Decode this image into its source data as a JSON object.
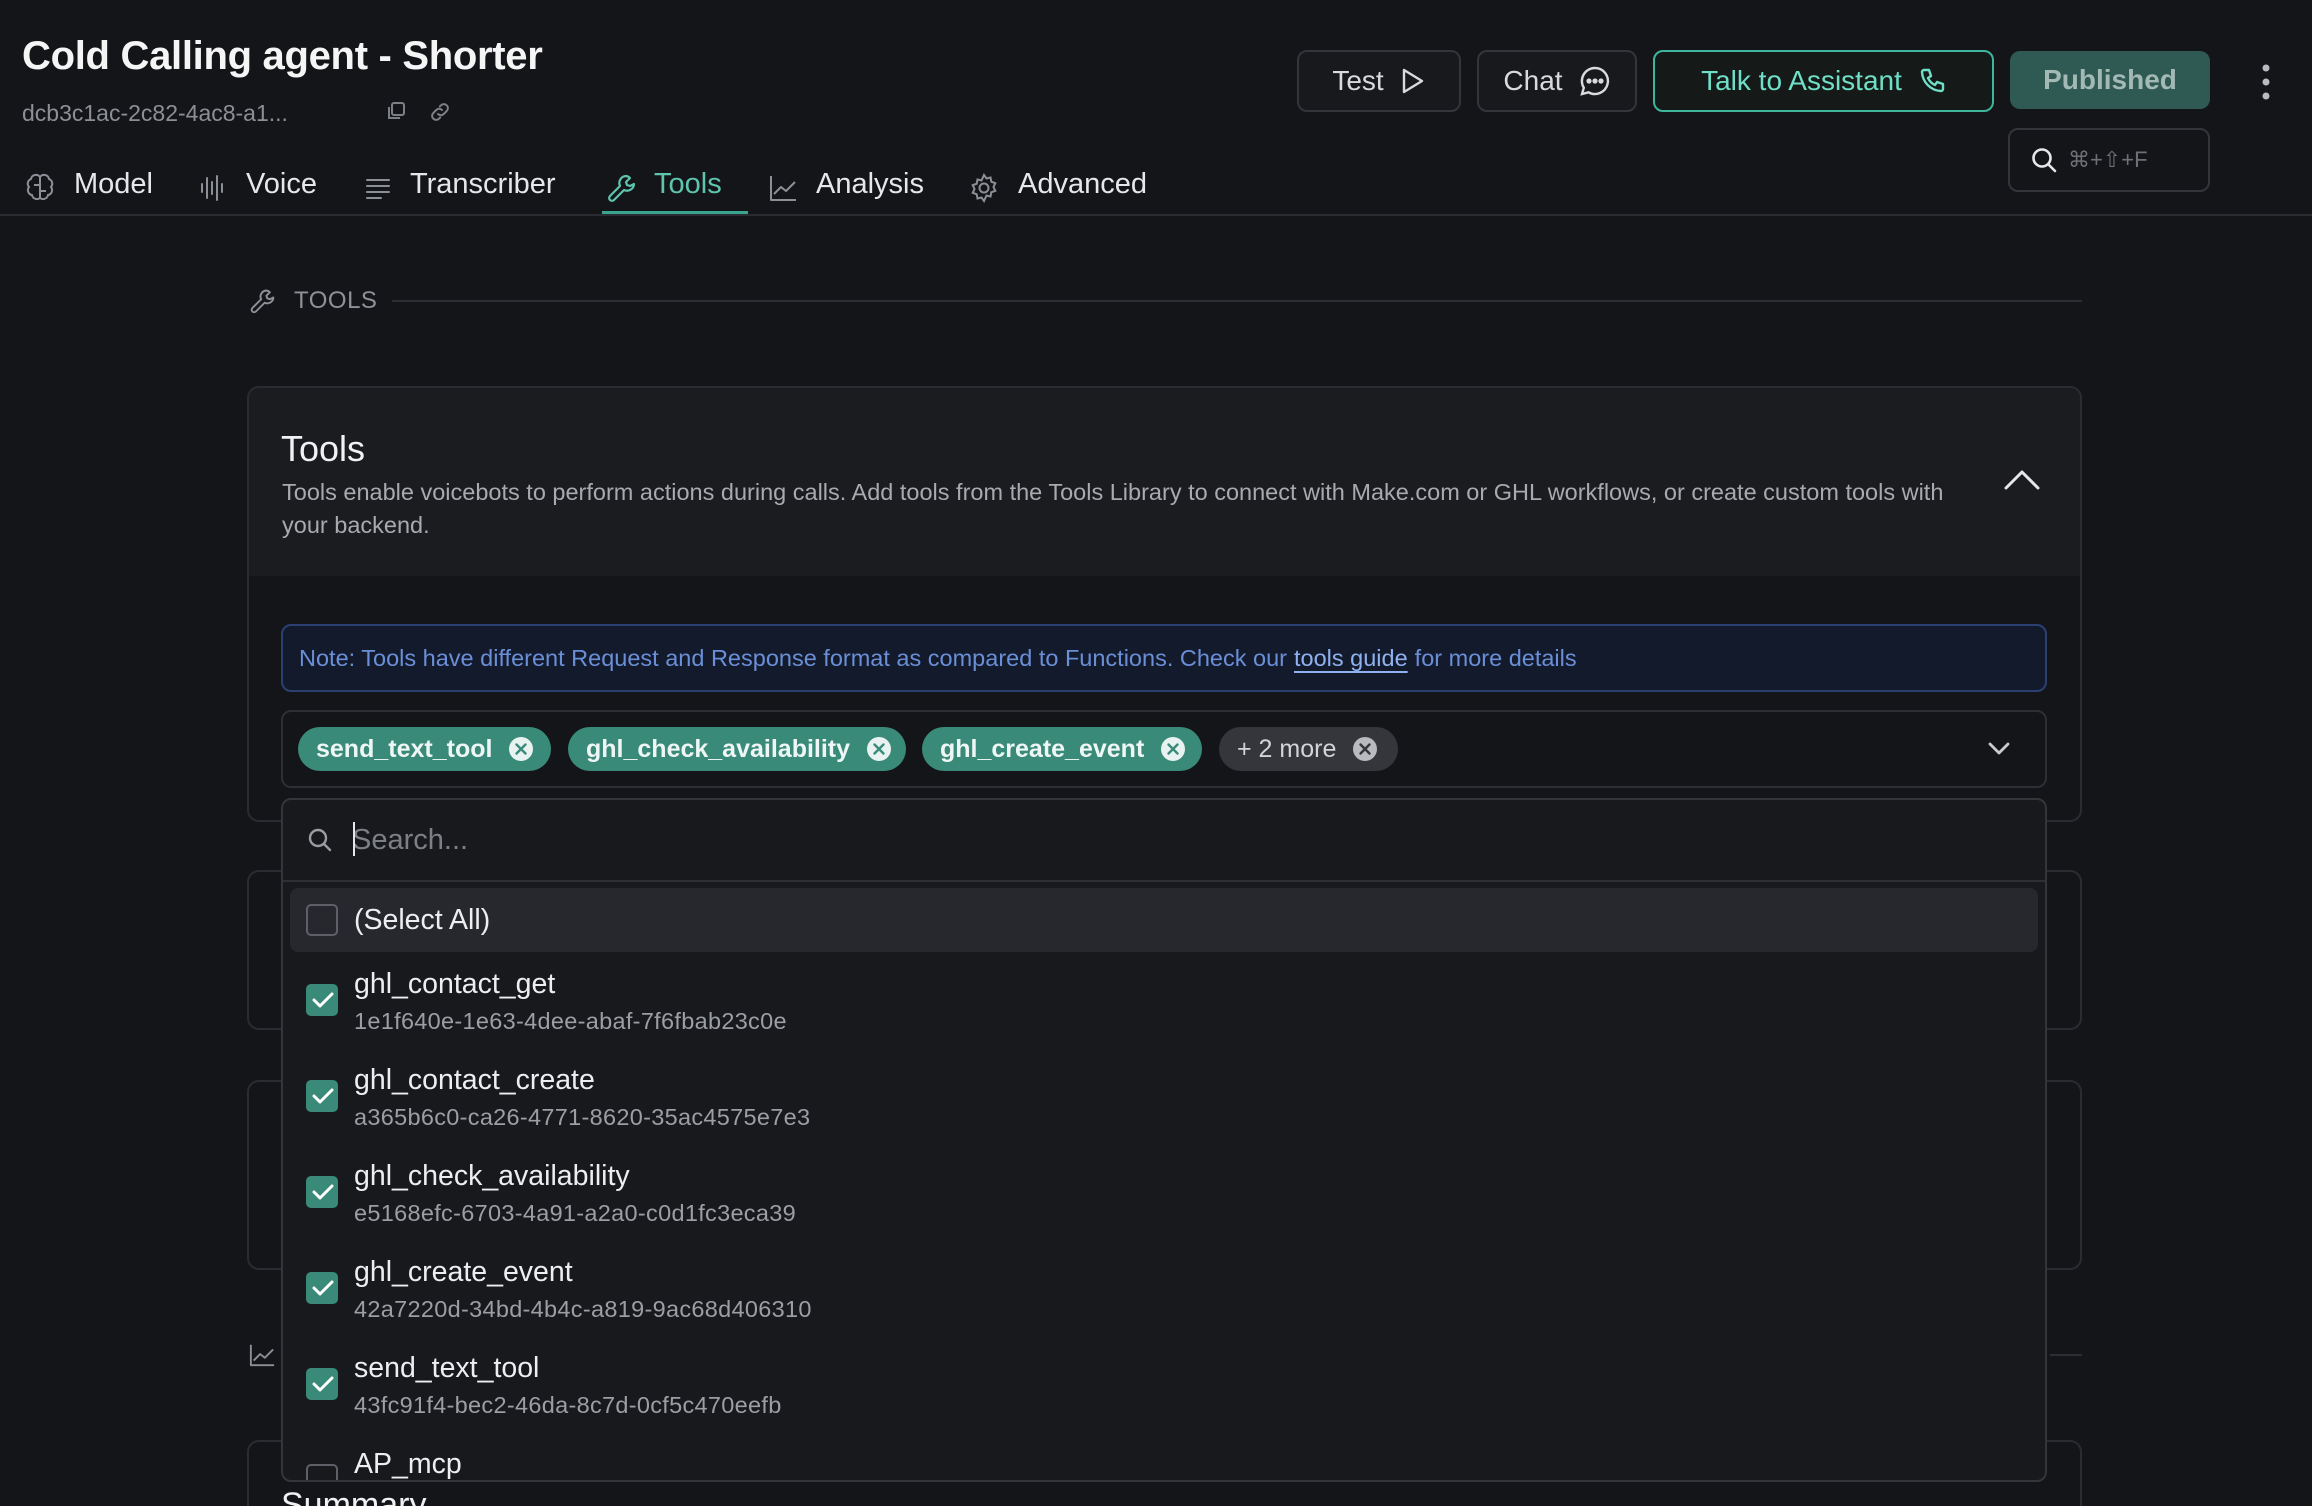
{
  "header": {
    "title": "Cold Calling agent - Shorter",
    "assistant_id": "dcb3c1ac-2c82-4ac8-a1...",
    "buttons": {
      "test": "Test",
      "chat": "Chat",
      "talk": "Talk to Assistant",
      "published": "Published"
    },
    "search_shortcut": "⌘+⇧+F"
  },
  "tabs": [
    {
      "label": "Model",
      "icon": "brain-icon"
    },
    {
      "label": "Voice",
      "icon": "waveform-icon"
    },
    {
      "label": "Transcriber",
      "icon": "lines-icon"
    },
    {
      "label": "Tools",
      "icon": "wrench-icon",
      "active": true
    },
    {
      "label": "Analysis",
      "icon": "chart-icon"
    },
    {
      "label": "Advanced",
      "icon": "gear-icon"
    }
  ],
  "section": {
    "heading": "TOOLS"
  },
  "tools_card": {
    "title": "Tools",
    "description": "Tools enable voicebots to perform actions during calls. Add tools from the Tools Library to connect with Make.com or GHL workflows, or create custom tools with your backend.",
    "note_prefix": "Note: Tools have different Request and Response format as compared to Functions. Check our",
    "note_link": "tools guide",
    "note_suffix": "for more details",
    "chips": [
      "send_text_tool",
      "ghl_check_availability",
      "ghl_create_event",
      "+ 2 more"
    ]
  },
  "dropdown": {
    "search_placeholder": "Search...",
    "select_all": "(Select All)",
    "options": [
      {
        "name": "ghl_contact_get",
        "id": "1e1f640e-1e63-4dee-abaf-7f6fbab23c0e",
        "checked": true
      },
      {
        "name": "ghl_contact_create",
        "id": "a365b6c0-ca26-4771-8620-35ac4575e7e3",
        "checked": true
      },
      {
        "name": "ghl_check_availability",
        "id": "e5168efc-6703-4a91-a2a0-c0d1fc3eca39",
        "checked": true
      },
      {
        "name": "ghl_create_event",
        "id": "42a7220d-34bd-4b4c-a819-9ac68d406310",
        "checked": true
      },
      {
        "name": "send_text_tool",
        "id": "43fc91f4-bec2-46da-8c7d-0cf5c470eefb",
        "checked": true
      },
      {
        "name": "AP_mcp",
        "id": "",
        "checked": false
      }
    ]
  },
  "background": {
    "summary_title": "Summary"
  },
  "colors": {
    "accent": "#3a8a79",
    "accent_text": "#5ec4ad",
    "background": "#141518",
    "note_blue": "#6a8fd8"
  }
}
